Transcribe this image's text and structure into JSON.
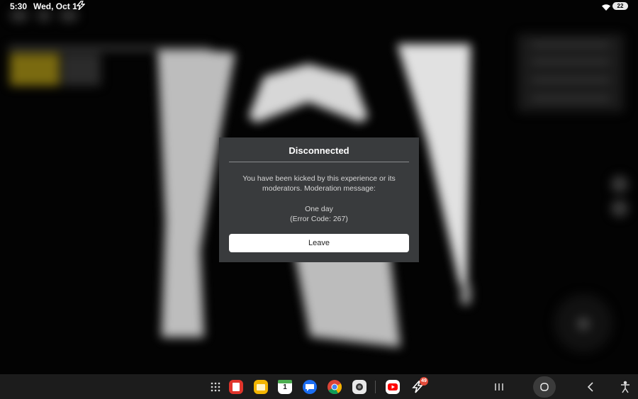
{
  "status_bar": {
    "time": "5:30",
    "date": "Wed, Oct 1",
    "battery": "22",
    "icons": [
      "flash-icon",
      "wifi-icon",
      "battery-icon"
    ]
  },
  "dialog": {
    "title": "Disconnected",
    "message": "You have been kicked by this experience or its moderators. Moderation message:",
    "reason": "One day",
    "error_code": "(Error Code: 267)",
    "leave_label": "Leave"
  },
  "taskbar": {
    "apps": [
      {
        "name": "app-drawer-icon"
      },
      {
        "name": "notes-app-icon",
        "color": "#e0342b"
      },
      {
        "name": "folder-app-icon",
        "color": "#f3b500"
      },
      {
        "name": "calendar-app-icon",
        "label": "1",
        "color": "#ffffff"
      },
      {
        "name": "messages-app-icon",
        "color": "#1b6ef3"
      },
      {
        "name": "chrome-app-icon"
      },
      {
        "name": "camera-app-icon",
        "color": "#e9e9e9"
      },
      {
        "name": "youtube-app-icon",
        "color": "#ff0000"
      },
      {
        "name": "flash-app-icon"
      }
    ],
    "notification_badge": "49",
    "nav": [
      "recents-button",
      "home-button",
      "back-button",
      "accessibility-button"
    ]
  }
}
